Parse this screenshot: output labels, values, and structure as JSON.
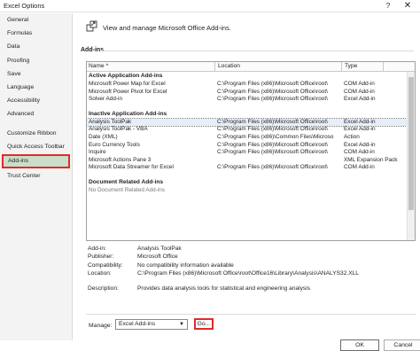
{
  "window": {
    "title": "Excel Options",
    "help": "?",
    "close": "✕"
  },
  "sidebar": {
    "items": [
      {
        "label": "General"
      },
      {
        "label": "Formulas"
      },
      {
        "label": "Data"
      },
      {
        "label": "Proofing"
      },
      {
        "label": "Save"
      },
      {
        "label": "Language"
      },
      {
        "label": "Accessibility"
      },
      {
        "label": "Advanced"
      },
      {
        "label": "Customize Ribbon"
      },
      {
        "label": "Quick Access Toolbar"
      },
      {
        "label": "Add-ins"
      },
      {
        "label": "Trust Center"
      }
    ],
    "selected": "Add-ins"
  },
  "header": {
    "text": "View and manage Microsoft Office Add-ins."
  },
  "section": {
    "title": "Add-ins"
  },
  "grid": {
    "columns": {
      "name": "Name ^",
      "location": "Location",
      "type": "Type"
    },
    "groups": [
      {
        "title": "Active Application Add-ins",
        "rows": [
          {
            "name": "Microsoft Power Map for Excel",
            "location": "C:\\Program Files (x86)\\Microsoft Office\\root\\",
            "type": "COM Add-in"
          },
          {
            "name": "Microsoft Power Pivot for Excel",
            "location": "C:\\Program Files (x86)\\Microsoft Office\\root\\",
            "type": "COM Add-in"
          },
          {
            "name": "Solver Add-in",
            "location": "C:\\Program Files (x86)\\Microsoft Office\\root\\",
            "type": "Excel Add-in"
          }
        ]
      },
      {
        "title": "Inactive Application Add-ins",
        "rows": [
          {
            "name": "Analysis ToolPak",
            "location": "C:\\Program Files (x86)\\Microsoft Office\\root\\",
            "type": "Excel Add-in"
          },
          {
            "name": "Analysis ToolPak - VBA",
            "location": "C:\\Program Files (x86)\\Microsoft Office\\root\\",
            "type": "Excel Add-in"
          },
          {
            "name": "Date (XML)",
            "location": "C:\\Program Files (x86)\\Common Files\\Microso",
            "type": "Action"
          },
          {
            "name": "Euro Currency Tools",
            "location": "C:\\Program Files (x86)\\Microsoft Office\\root\\",
            "type": "Excel Add-in"
          },
          {
            "name": "Inquire",
            "location": "C:\\Program Files (x86)\\Microsoft Office\\root\\",
            "type": "COM Add-in"
          },
          {
            "name": "Microsoft Actions Pane 3",
            "location": "",
            "type": "XML Expansion Pack"
          },
          {
            "name": "Microsoft Data Streamer for Excel",
            "location": "C:\\Program Files (x86)\\Microsoft Office\\root\\",
            "type": "COM Add-in"
          }
        ]
      },
      {
        "title": "Document Related Add-ins",
        "rows": [
          {
            "name": "No Document Related Add-ins",
            "location": "",
            "type": ""
          }
        ]
      }
    ]
  },
  "details": {
    "addin_label": "Add-in:",
    "addin": "Analysis ToolPak",
    "publisher_label": "Publisher:",
    "publisher": "Microsoft Office",
    "compat_label": "Compatibility:",
    "compat": "No compatibility information available",
    "location_label": "Location:",
    "location": "C:\\Program Files (x86)\\Microsoft Office\\root\\Office16\\Library\\Analysis\\ANALYS32.XLL",
    "description_label": "Description:",
    "description": "Provides data analysis tools for statistical and engineering analysis"
  },
  "manage": {
    "label": "Manage:",
    "value": "Excel Add-ins",
    "go": "Go..."
  },
  "buttons": {
    "ok": "OK",
    "cancel": "Cancel"
  },
  "colors": {
    "selected_nav_bg": "#c9dfc9",
    "highlight_border": "#e02b2b"
  }
}
